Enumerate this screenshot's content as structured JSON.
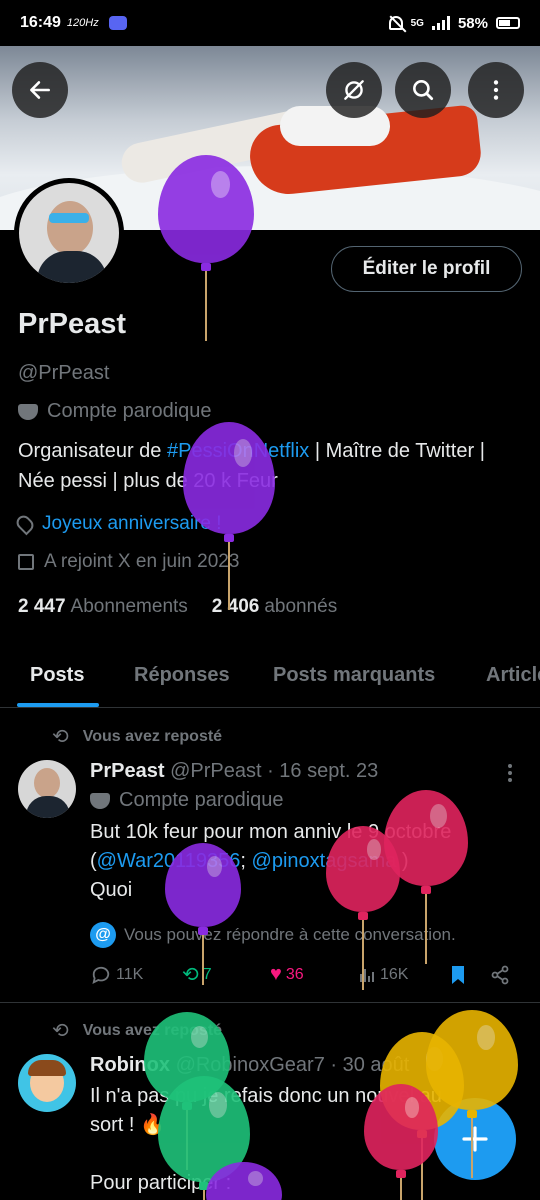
{
  "status_bar": {
    "time": "16:49",
    "refresh": "120Hz",
    "network": "5G",
    "battery": "58%"
  },
  "profile": {
    "name": "PrPeast",
    "handle": "@PrPeast",
    "parody_label": "Compte parodique",
    "edit_button": "Éditer le profil",
    "bio_part1": "Organisateur de ",
    "bio_hashtag": "#PessiOnNetflix",
    "bio_part2": " | Maître de Twitter | Née pessi | plus de 20 k Feur",
    "location_link": "Joyeux anniversaire !",
    "joined": "A rejoint X en juin 2023",
    "following_count": "2 447",
    "following_label": "Abonnements",
    "followers_count": "2 406",
    "followers_label": "abonnés"
  },
  "tabs": [
    "Posts",
    "Réponses",
    "Posts marquants",
    "Articles"
  ],
  "posts": [
    {
      "repost_label": "Vous avez reposté",
      "author": "PrPeast",
      "handle_date": "@PrPeast · 16 sept. 23",
      "parody_label": "Compte parodique",
      "text1": "But 10k feur pour mon anniv le 9 octobre",
      "text2_open": "(",
      "mention1": "@War20119356",
      "sep": "; ",
      "mention2": "@pinoxtagsama",
      "text2_close": " )",
      "text3": "Quoi",
      "notice": "Vous pouvez répondre à cette conversation.",
      "replies": "11K",
      "reposts": "7",
      "likes": "36",
      "views": "16K"
    },
    {
      "repost_label": "Vous avez reposté",
      "author": "Robinox",
      "handle_date": "@RobinoxGear7 · 30 août",
      "text1": "Il n'a pas pu je refais donc un nouvel au",
      "text2": "sort ! 🔥",
      "text3": "Pour participer :"
    }
  ],
  "colors": {
    "accent": "#1d9bf0",
    "like": "#f91880",
    "repost": "#00ba7c",
    "muted": "#71767b"
  }
}
